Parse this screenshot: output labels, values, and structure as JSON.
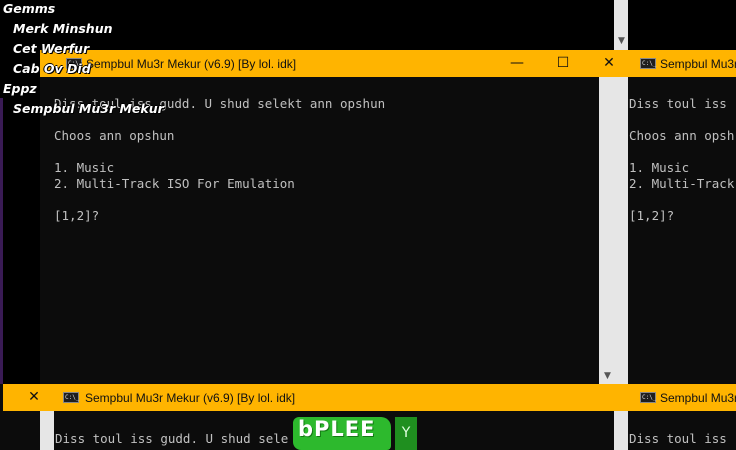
{
  "menu": {
    "games_heading": "Gemms",
    "games": [
      "Merk Minshun",
      "Cet Werfur",
      "Cab Ov Did"
    ],
    "apps_heading": "Eppz",
    "apps": [
      "Sempbul Mu3r Mekur"
    ]
  },
  "window_title": "Sempbul Mu3r Mekur (v6.9) [By lol. idk]",
  "window_title_short": "Sempbul Mu3r Mekur",
  "console": {
    "line1": "Diss toul iss gudd. U shud selekt ann opshun",
    "line2": "Choos ann opshun",
    "option1": "1. Music",
    "option2": "2. Multi-Track ISO For Emulation",
    "prompt": "[1,2]?"
  },
  "console_right": {
    "line1": "Diss toul iss",
    "line2": "Choos ann opsh",
    "option1": "1. Music",
    "option2": "2. Multi-Track",
    "prompt": "[1,2]?"
  },
  "console_bottom": {
    "line1": "Diss toul iss gudd. U shud sele",
    "line1_right": "Diss toul iss"
  },
  "buttons": {
    "minimize": "—",
    "maximize": "☐",
    "close": "✕"
  },
  "doodle": {
    "text": "bPLEE",
    "badge": "Y"
  },
  "colors": {
    "titlebar": "#ffb400",
    "console_bg": "#0c0c0c",
    "console_text": "#c0c0c0",
    "doodle_green": "#2db92d"
  }
}
